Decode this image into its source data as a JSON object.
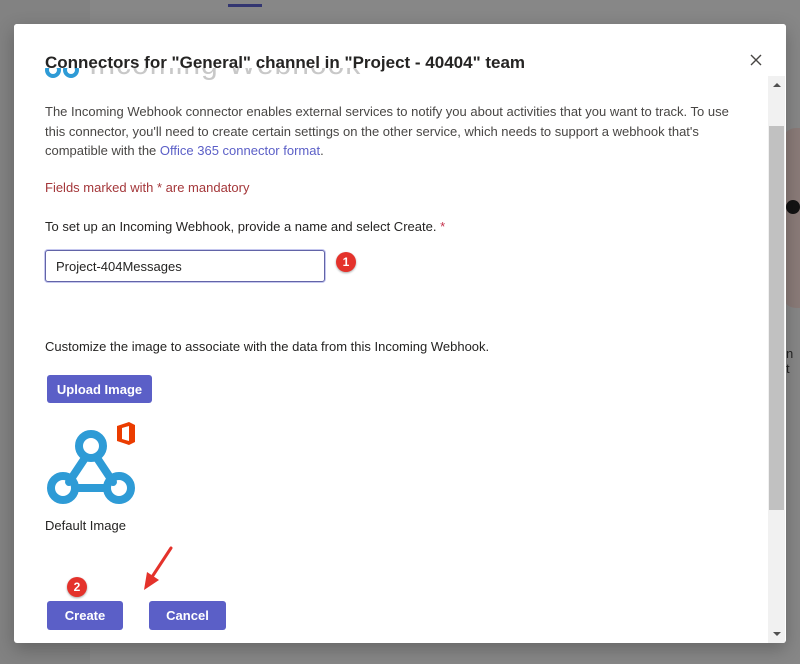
{
  "dialog": {
    "title": "Connectors for \"General\" channel in \"Project - 40404\" team",
    "header_peek_text": "Incoming Webhook"
  },
  "description": {
    "text": "The Incoming Webhook connector enables external services to notify you about activities that you want to track. To use this connector, you'll need to create certain settings on the other service, which needs to support a webhook that's compatible with the ",
    "link_text": "Office 365 connector format",
    "suffix": "."
  },
  "form": {
    "mandatory_note": "Fields marked with * are mandatory",
    "setup_label": "To set up an Incoming Webhook, provide a name and select Create.",
    "required_marker": "*",
    "name_value": "Project-404Messages",
    "customize_label": "Customize the image to associate with the data from this Incoming Webhook.",
    "upload_button": "Upload Image",
    "default_image_label": "Default Image",
    "create_button": "Create",
    "cancel_button": "Cancel"
  },
  "annotations": {
    "step1": "1",
    "step2": "2"
  },
  "background": {
    "side_text": "n t"
  },
  "colors": {
    "accent": "#5b5fc7",
    "mandatory": "#a4373a",
    "badge": "#e4322b",
    "webhook_blue": "#2e9bd6",
    "office_orange": "#eb3c00"
  }
}
